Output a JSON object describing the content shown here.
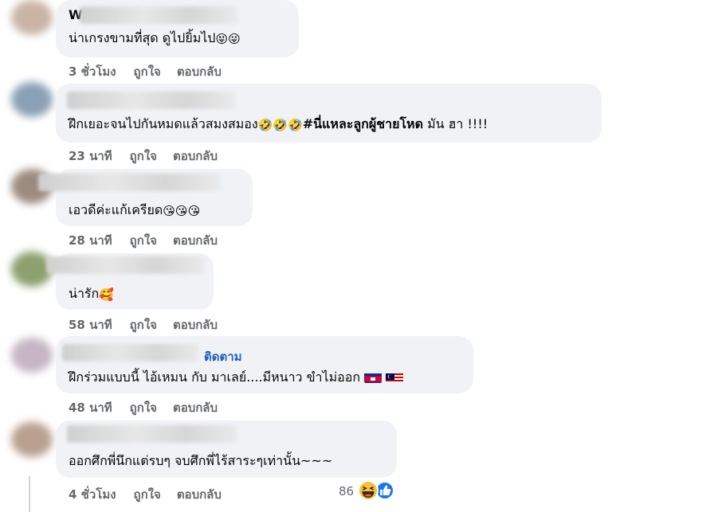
{
  "comments": [
    {
      "author": "W",
      "text": "น่าเกรงขามที่สุด ดูไปยิ้มไป",
      "emojis": [
        "😝",
        "😜"
      ],
      "time": "3 ชั่วโมง",
      "like": "ถูกใจ",
      "reply": "ตอบกลับ"
    },
    {
      "text": "ฝึกเยอะจนไปกันหมดแล้วสมงสมอง",
      "emojis": [
        "🤣",
        "🤣",
        "🤣"
      ],
      "hashtag": "#นี่แหละลูกผู้ชายโหด",
      "text_after": "มัน ฮา !!!!",
      "time": "23 นาที",
      "like": "ถูกใจ",
      "reply": "ตอบกลับ"
    },
    {
      "text": "เอวดีค่ะแก้เครียด",
      "emojis": [
        "😘",
        "😘",
        "😘"
      ],
      "time": "28 นาที",
      "like": "ถูกใจ",
      "reply": "ตอบกลับ"
    },
    {
      "text": "น่ารัก",
      "emojis": [
        "🥰"
      ],
      "time": "58 นาที",
      "like": "ถูกใจ",
      "reply": "ตอบกลับ"
    },
    {
      "follow": "ติดตาม",
      "text": "ฝึกร่วมแบบนี้ ไอ้เหมน กับ มาเลย์....มีหนาว ขำไม่ออก",
      "flags": [
        "kh-flag",
        "my-flag"
      ],
      "time": "48 นาที",
      "like": "ถูกใจ",
      "reply": "ตอบกลับ"
    },
    {
      "text": "ออกศึกพี่นึกแต่รบๆ จบศึกพี่ไร้สาระๆเท่านั้น~~~",
      "time": "4 ชั่วโมง",
      "like": "ถูกใจ",
      "reply": "ตอบกลับ",
      "reaction_count": "86",
      "reaction_icons": [
        "haha-icon",
        "like-icon"
      ]
    }
  ],
  "colors": {
    "bubble": "#f0f2f5",
    "action_text": "#65676b",
    "follow_link": "#1f5fbf"
  }
}
